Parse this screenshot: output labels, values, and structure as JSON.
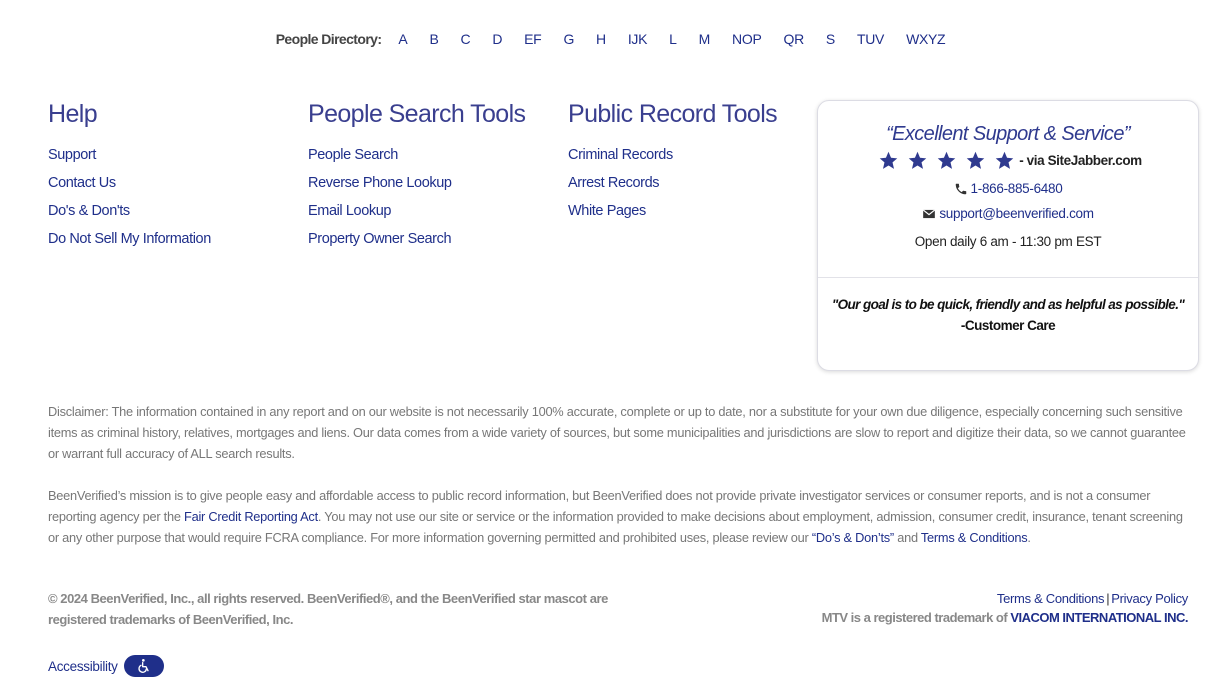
{
  "directory": {
    "label": "People Directory:",
    "letters": [
      "A",
      "B",
      "C",
      "D",
      "EF",
      "G",
      "H",
      "IJK",
      "L",
      "M",
      "NOP",
      "QR",
      "S",
      "TUV",
      "WXYZ"
    ]
  },
  "help": {
    "title": "Help",
    "links": [
      "Support",
      "Contact Us",
      "Do's & Don'ts",
      "Do Not Sell My Information"
    ]
  },
  "people_tools": {
    "title": "People Search Tools",
    "links": [
      "People Search",
      "Reverse Phone Lookup",
      "Email Lookup",
      "Property Owner Search"
    ]
  },
  "public_tools": {
    "title": "Public Record Tools",
    "links": [
      "Criminal Records",
      "Arrest Records",
      "White Pages"
    ]
  },
  "card": {
    "quote": "“Excellent Support & Service”",
    "rating_stars": 5,
    "via": "- via SiteJabber.com",
    "phone": "1-866-885-6480",
    "email": "support@beenverified.com",
    "hours": "Open daily 6 am - 11:30 pm EST",
    "motto": "\"Our goal is to be quick, friendly and as helpful as possible.\"",
    "motto_signature": "-Customer Care",
    "star_color": "#2f3a8f"
  },
  "disclaimer": "Disclaimer: The information contained in any report and on our website is not necessarily 100% accurate, complete or up to date, nor a substitute for your own due diligence, especially concerning such sensitive items as criminal history, relatives, mortgages and liens. Our data comes from a wide variety of sources, but some municipalities and jurisdictions are slow to report and digitize their data, so we cannot guarantee or warrant full accuracy of ALL search results.",
  "mission": {
    "part1": "BeenVerified’s mission is to give people easy and affordable access to public record information, but BeenVerified does not provide private investigator services or consumer reports, and is not a consumer reporting agency per the ",
    "fcra_link": "Fair Credit Reporting Act",
    "part2": ". You may not use our site or service or the information provided to make decisions about employment, admission, consumer credit, insurance, tenant screening or any other purpose that would require FCRA compliance. For more information governing permitted and prohibited uses, please review our ",
    "dos_link": "“Do’s & Don’ts”",
    "part3": " and ",
    "terms_link": "Terms & Conditions",
    "part4": "."
  },
  "copyright": "© 2024 BeenVerified, Inc., all rights reserved. BeenVerified®, and the BeenVerified star mascot are registered trademarks of BeenVerified, Inc.",
  "footer": {
    "terms": "Terms & Conditions",
    "separator": "|",
    "privacy": "Privacy Policy",
    "mtv_text": "MTV is a registered trademark of ",
    "viacom": "VIACOM INTERNATIONAL INC."
  },
  "accessibility": {
    "label": "Accessibility",
    "icon": "wheelchair-icon"
  },
  "colors": {
    "link": "#1f2f8a",
    "heading": "#3a3f8f",
    "muted": "#777777"
  }
}
